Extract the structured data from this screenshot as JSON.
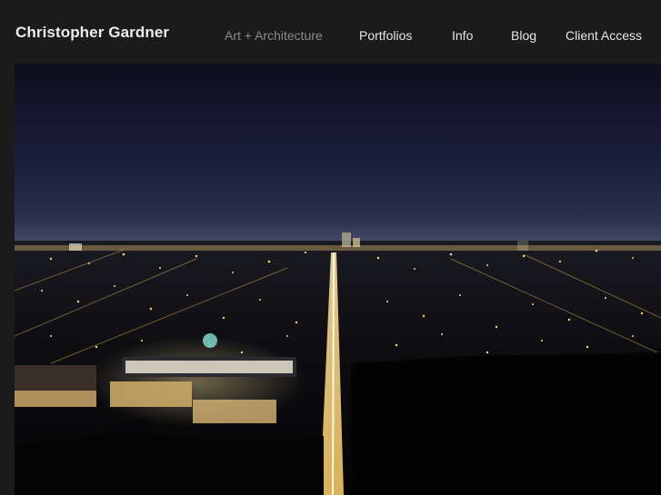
{
  "header": {
    "site_title": "Christopher Gardner",
    "nav": [
      {
        "label": "Art + Architecture",
        "state": "active"
      },
      {
        "label": "Portfolios"
      },
      {
        "label": "Info"
      },
      {
        "label": "Blog"
      },
      {
        "label": "Client Access"
      }
    ]
  },
  "photo": {
    "subject": "Night aerial photograph of a city with a long illuminated avenue",
    "sky_color": "#1c1e3a",
    "horizon_glow": "#4a4a6a",
    "lights_color": "#ffd27a"
  }
}
